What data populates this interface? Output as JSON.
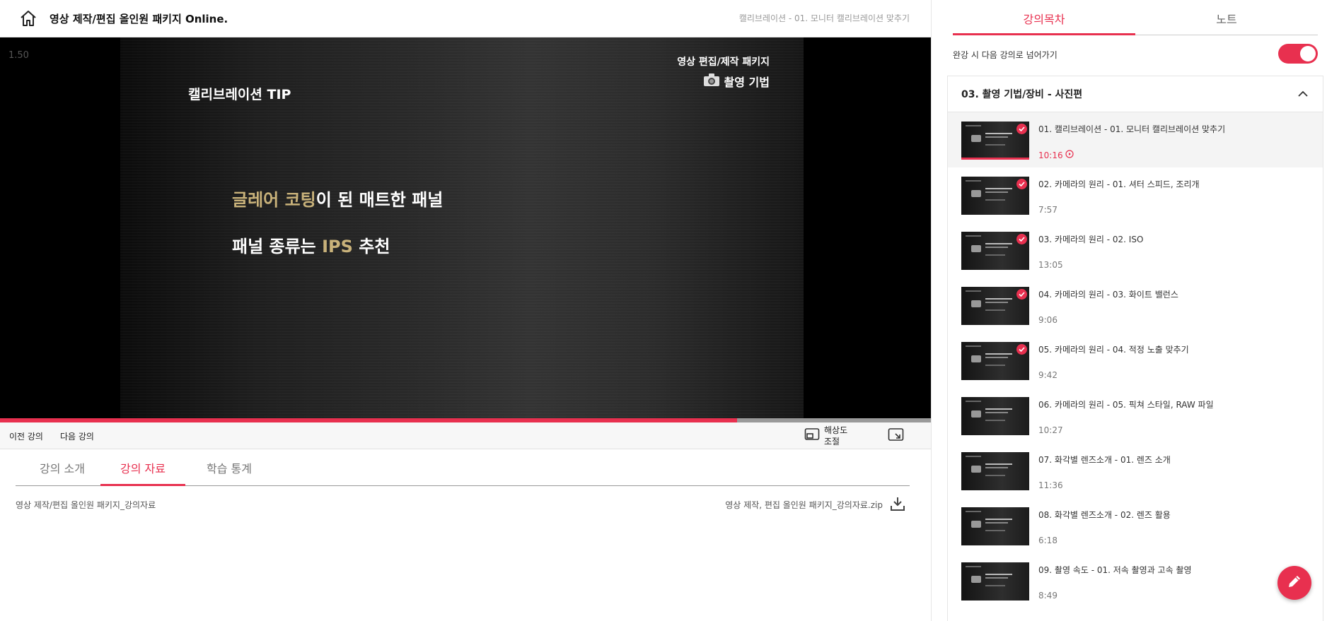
{
  "header": {
    "course_title": "영상 제작/편집 올인원 패키지 Online.",
    "current_lecture": "캘리브레이션 - 01. 모니터 캘리브레이션 맞추기",
    "home_icon": "home-icon"
  },
  "player": {
    "speed": "1.50",
    "progress": 0.792,
    "slide": {
      "brand_line1": "영상 편집/제작 패키지",
      "brand_line2": "촬영 기법",
      "tip_title": "캘리브레이션 TIP",
      "line1_highlight": "글레어 코팅",
      "line1_rest": "이 된 매트한 패널",
      "line2_start": "패널 종류는 ",
      "line2_highlight": "IPS",
      "line2_end": " 추천",
      "highlight_color": "#c9b27a"
    }
  },
  "controls": {
    "prev_label": "이전 강의",
    "next_label": "다음 강의",
    "resolution_label": "해상도 조절",
    "resolution_icon": "resolution-icon",
    "pip_icon": "picture-in-picture-icon"
  },
  "tabs": {
    "intro": "강의 소개",
    "materials": "강의 자료",
    "stats": "학습 통계",
    "active": "materials"
  },
  "materials": {
    "name": "영상 제작/편집 올인원 패키지_강의자료",
    "file": "영상 제작, 편집 올인원 패키지_강의자료.zip",
    "download_icon": "download-icon"
  },
  "sidebar": {
    "tabs": {
      "toc": "강의목차",
      "note": "노트",
      "active": "toc"
    },
    "autoplay": {
      "label": "완강 시 다음 강의로 넘어가기",
      "on": true
    },
    "section_title": "03. 촬영 기법/장비 - 사진편",
    "lectures": [
      {
        "title": "01. 캘리브레이션 - 01. 모니터 캘리브레이션 맞추기",
        "duration": "10:16",
        "done": true,
        "active": true,
        "watched": 1.0
      },
      {
        "title": "02. 카메라의 원리 - 01. 셔터 스피드, 조리개",
        "duration": "7:57",
        "done": true,
        "active": false,
        "watched": 0
      },
      {
        "title": "03. 카메라의 원리 - 02. ISO",
        "duration": "13:05",
        "done": true,
        "active": false,
        "watched": 0
      },
      {
        "title": "04. 카메라의 원리 - 03. 화이트 밸런스",
        "duration": "9:06",
        "done": true,
        "active": false,
        "watched": 0
      },
      {
        "title": "05. 카메라의 원리 - 04. 적정 노출 맞추기",
        "duration": "9:42",
        "done": true,
        "active": false,
        "watched": 0
      },
      {
        "title": "06. 카메라의 원리 - 05. 픽쳐 스타일, RAW 파일",
        "duration": "10:27",
        "done": false,
        "active": false,
        "watched": 0
      },
      {
        "title": "07. 화각별 렌즈소개 - 01. 렌즈 소개",
        "duration": "11:36",
        "done": false,
        "active": false,
        "watched": 0
      },
      {
        "title": "08. 화각별 렌즈소개 - 02. 렌즈 활용",
        "duration": "6:18",
        "done": false,
        "active": false,
        "watched": 0
      },
      {
        "title": "09. 촬영 속도 - 01. 저속 촬영과 고속 촬영",
        "duration": "8:49",
        "done": false,
        "active": false,
        "watched": 0
      }
    ]
  },
  "colors": {
    "accent": "#e8304f"
  }
}
